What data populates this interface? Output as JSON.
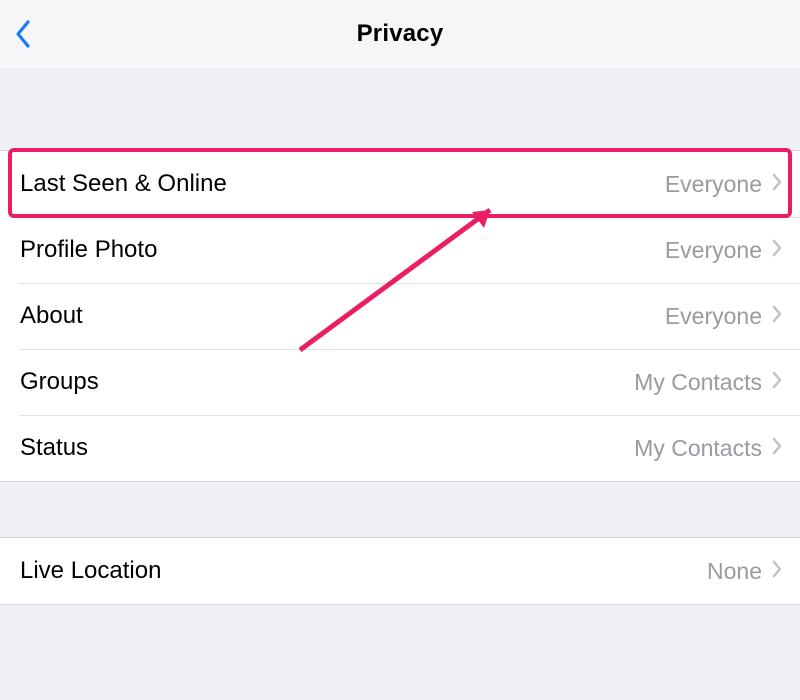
{
  "navbar": {
    "title": "Privacy",
    "back_icon": "chevron-left"
  },
  "sections": [
    {
      "rows": [
        {
          "label": "Last Seen & Online",
          "value": "Everyone",
          "highlighted": true
        },
        {
          "label": "Profile Photo",
          "value": "Everyone"
        },
        {
          "label": "About",
          "value": "Everyone"
        },
        {
          "label": "Groups",
          "value": "My Contacts"
        },
        {
          "label": "Status",
          "value": "My Contacts"
        }
      ]
    },
    {
      "rows": [
        {
          "label": "Live Location",
          "value": "None"
        }
      ]
    }
  ],
  "annotation": {
    "highlight_color": "#e91e63",
    "arrow": true
  }
}
